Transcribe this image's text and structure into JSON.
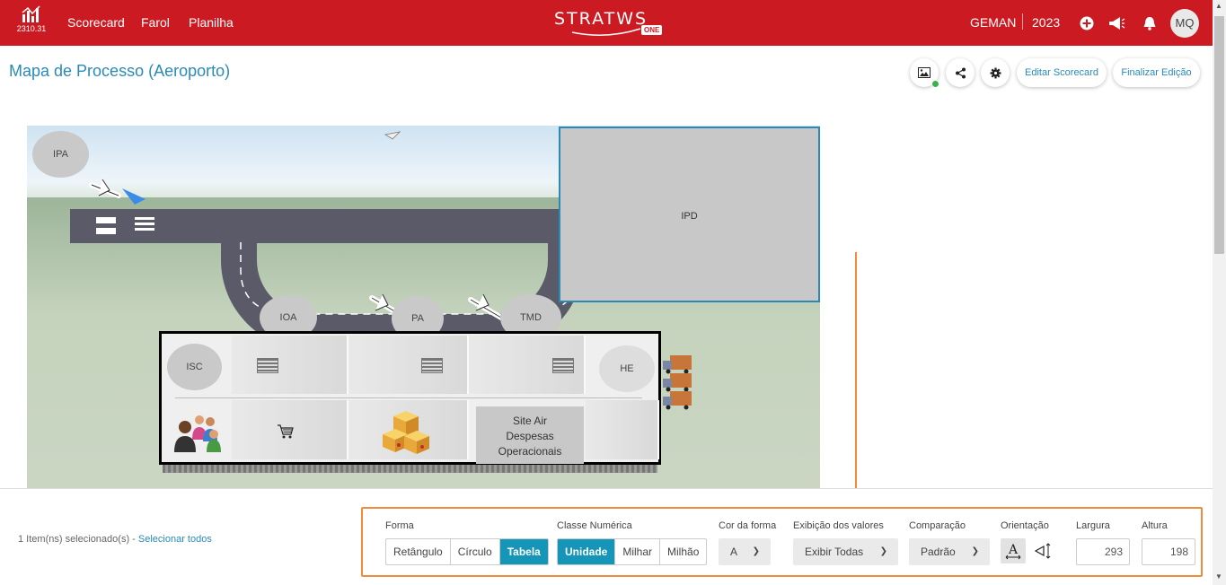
{
  "topbar": {
    "version": "2310.31",
    "nav": [
      "Scorecard",
      "Farol",
      "Planilha"
    ],
    "brand_word": "STRATWS",
    "brand_badge": "ONE",
    "org": "GEMAN",
    "year": "2023",
    "avatar_initials": "MQ",
    "icons": [
      "plus-circle-icon",
      "megaphone-icon",
      "bell-icon"
    ]
  },
  "page": {
    "title": "Mapa de Processo (Aeroporto)",
    "buttons": {
      "edit_scorecard": "Editar Scorecard",
      "finish_edit": "Finalizar Edição"
    }
  },
  "canvas": {
    "ovals": {
      "ipa": "IPA",
      "ioa": "IOA",
      "pa": "PA",
      "tmd": "TMD",
      "isc": "ISC",
      "he": "HE"
    },
    "ipd": "IPD",
    "site_box": [
      "Site Air",
      "Despesas",
      "Operacionais"
    ]
  },
  "bottom": {
    "selection_text": "1 Item(ns) selecionado(s) - ",
    "select_all": "Selecionar todos",
    "forma": {
      "label": "Forma",
      "options": [
        "Retângulo",
        "Círculo",
        "Tabela"
      ],
      "selected": "Tabela"
    },
    "classe": {
      "label": "Classe Numérica",
      "options": [
        "Unidade",
        "Milhar",
        "Milhão"
      ],
      "selected": "Unidade"
    },
    "cor": {
      "label": "Cor da forma",
      "value": "A"
    },
    "exibicao": {
      "label": "Exibição dos valores",
      "value": "Exibir Todas"
    },
    "comparacao": {
      "label": "Comparação",
      "value": "Padrão"
    },
    "orientacao": {
      "label": "Orientação"
    },
    "largura": {
      "label": "Largura",
      "value": "293"
    },
    "altura": {
      "label": "Altura",
      "value": "198"
    }
  },
  "colors": {
    "brand_red": "#cc1a22",
    "accent_blue": "#1596b8",
    "highlight_orange": "#f08a3c"
  }
}
